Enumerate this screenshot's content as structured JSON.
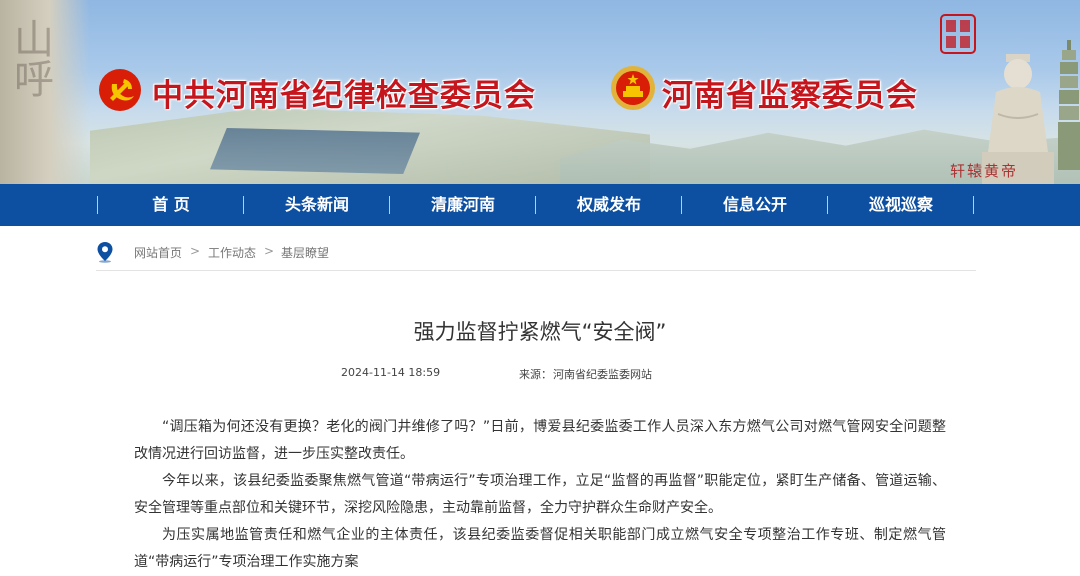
{
  "banner": {
    "title_left": "中共河南省纪律检查委员会",
    "title_right": "河南省监察委员会",
    "statue_caption": "轩辕黄帝",
    "cliff_text": "山呼",
    "colors": {
      "title": "#c4161c",
      "nav": "#0d4fa0"
    }
  },
  "nav": {
    "items": [
      {
        "label": "首 页"
      },
      {
        "label": "头条新闻"
      },
      {
        "label": "清廉河南"
      },
      {
        "label": "权威发布"
      },
      {
        "label": "信息公开"
      },
      {
        "label": "巡视巡察"
      }
    ]
  },
  "breadcrumb": {
    "icon": "location-pin-icon",
    "items": [
      {
        "label": "网站首页"
      },
      {
        "label": "工作动态"
      },
      {
        "label": "基层瞭望"
      }
    ],
    "separator": ">"
  },
  "article": {
    "title": "强力监督拧紧燃气“安全阀”",
    "date": "2024-11-14 18:59",
    "source_label": "来源：",
    "source": "河南省纪委监委网站",
    "paragraphs": [
      "“调压箱为何还没有更换？老化的阀门井维修了吗？”日前，博爱县纪委监委工作人员深入东方燃气公司对燃气管网安全问题整改情况进行回访监督，进一步压实整改责任。",
      "今年以来，该县纪委监委聚焦燃气管道“带病运行”专项治理工作，立足“监督的再监督”职能定位，紧盯生产储备、管道运输、安全管理等重点部位和关键环节，深挖风险隐患，主动靠前监督，全力守护群众生命财产安全。",
      "为压实属地监管责任和燃气企业的主体责任，该县纪委监委督促相关职能部门成立燃气安全专项整治工作专班、制定燃气管道“带病运行”专项治理工作实施方案"
    ]
  }
}
